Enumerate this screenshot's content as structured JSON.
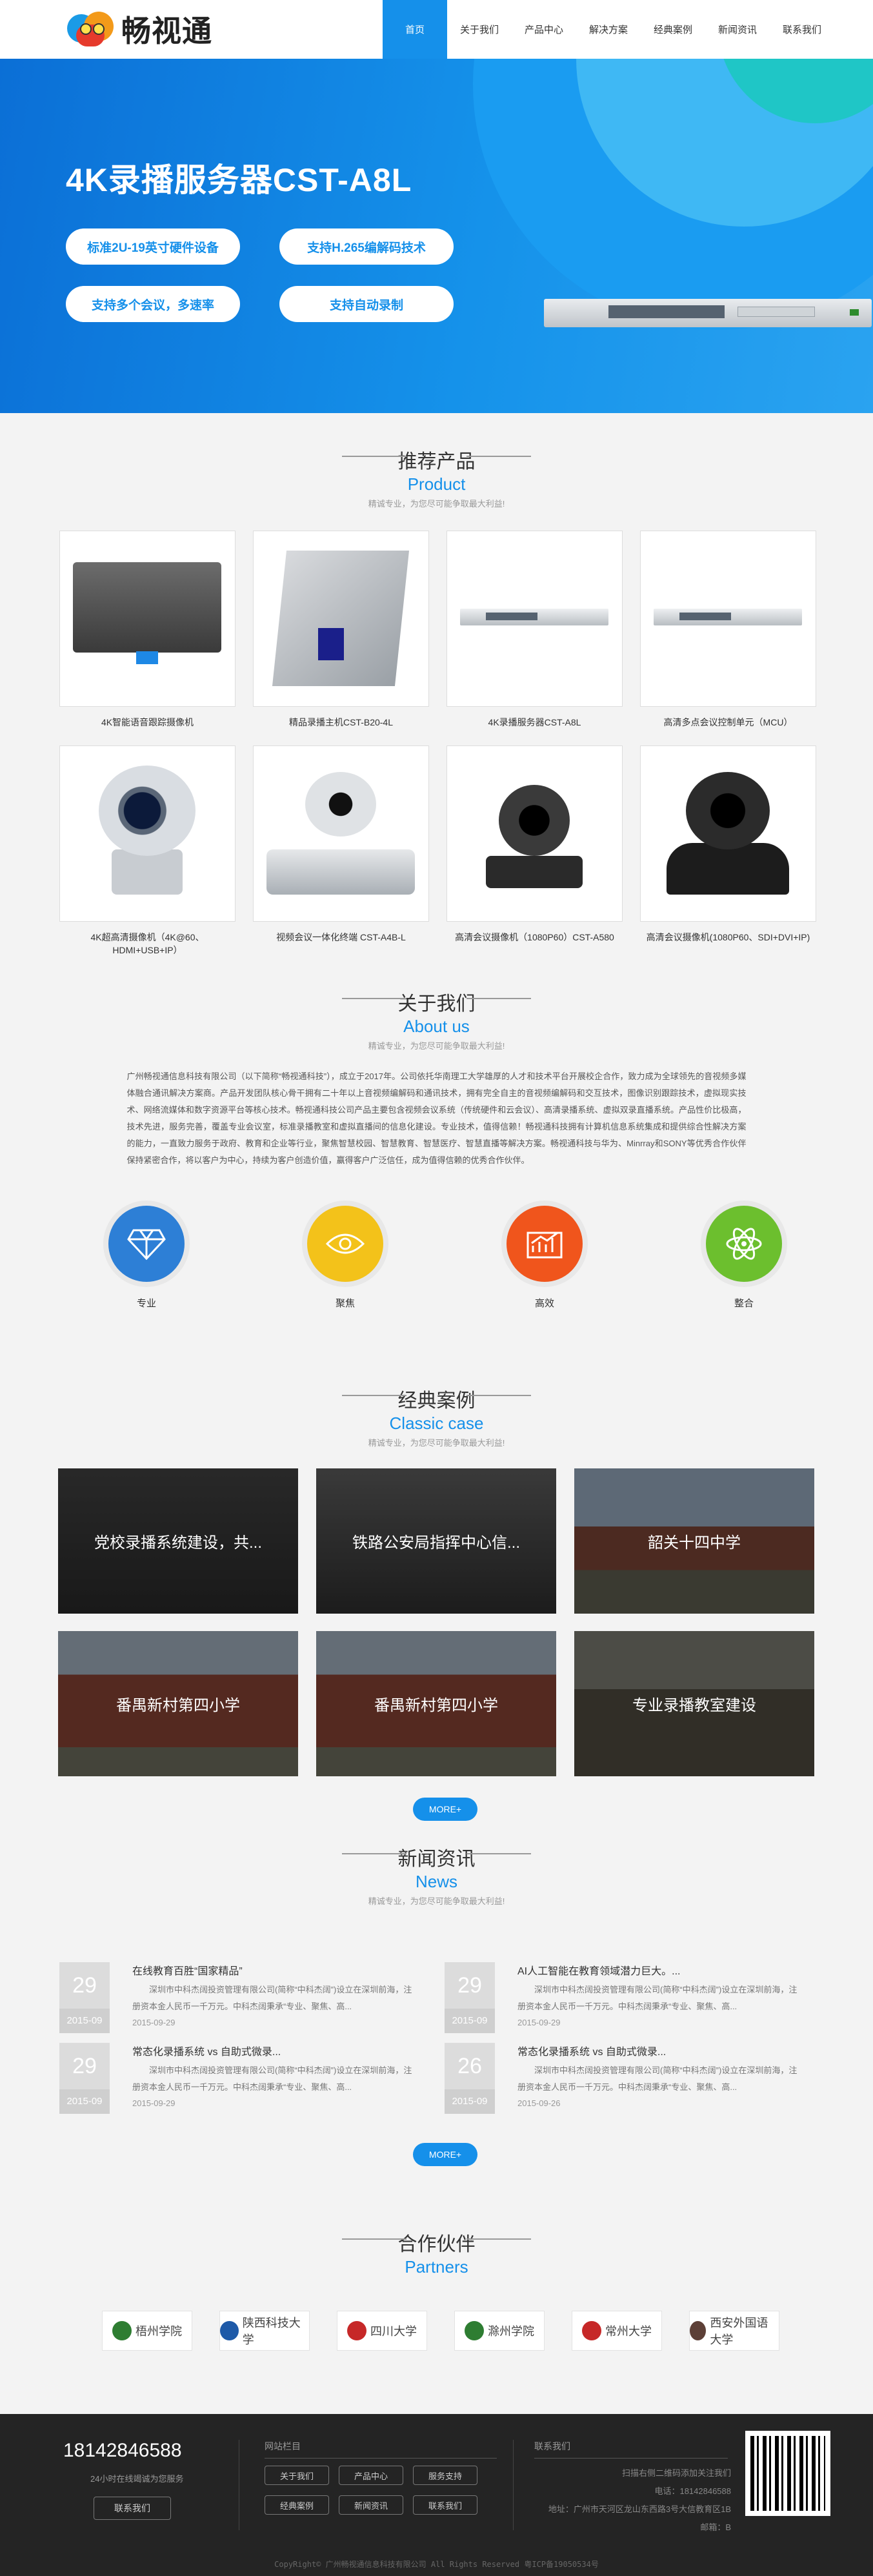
{
  "header": {
    "brand": "畅视通",
    "nav": [
      "首页",
      "关于我们",
      "产品中心",
      "解决方案",
      "经典案例",
      "新闻资讯",
      "联系我们"
    ],
    "active_index": 0
  },
  "banner": {
    "title": "4K录播服务器CST-A8L",
    "pills": [
      "标准2U-19英寸硬件设备",
      "支持H.265编解码技术",
      "支持多个会议，多速率",
      "支持自动录制"
    ],
    "slide_count": 3,
    "active_slide": 0
  },
  "products": {
    "title_cn": "推荐产品",
    "title_en": "Product",
    "subtitle": "精诚专业，为您尽可能争取最大利益!",
    "items": [
      {
        "name": "4K智能语音跟踪摄像机",
        "icon": "soundbar-camera"
      },
      {
        "name": "精品录播主机CST-B20-4L",
        "icon": "recording-host"
      },
      {
        "name": "4K录播服务器CST-A8L",
        "icon": "rack-server"
      },
      {
        "name": "高清多点会议控制单元（MCU）",
        "icon": "rack-server"
      },
      {
        "name": "4K超高清摄像机（4K@60、HDMI+USB+IP）",
        "icon": "ptz-camera"
      },
      {
        "name": "视频会议一体化终端 CST-A4B-L",
        "icon": "video-terminal"
      },
      {
        "name": "高清会议摄像机（1080P60）CST-A580",
        "icon": "ptz-camera"
      },
      {
        "name": "高清会议摄像机(1080P60、SDI+DVI+IP)",
        "icon": "ptz-camera-black"
      }
    ]
  },
  "about": {
    "title_cn": "关于我们",
    "title_en": "About us",
    "subtitle": "精诚专业，为您尽可能争取最大利益!",
    "text": "广州畅视通信息科技有限公司（以下简称“畅视通科技”），成立于2017年。公司依托华南理工大学雄厚的人才和技术平台开展校企合作，致力成为全球领先的音视频多媒体融合通讯解决方案商。产品开发团队核心骨干拥有二十年以上音视频编解码和通讯技术，拥有完全自主的音视频编解码和交互技术，图像识别跟踪技术，虚拟现实技术、网络流媒体和数字资源平台等核心技术。畅视通科技公司产品主要包含视频会议系统（传统硬件和云会议）、高清录播系统、虚拟双录直播系统。产品性价比极高，技术先进，服务完善，覆盖专业会议室，标准录播教室和虚拟直播间的信息化建设。专业技术，值得信赖！畅视通科技拥有计算机信息系统集成和提供综合性解决方案的能力，一直致力服务于政府、教育和企业等行业，聚焦智慧校园、智慧教育、智慧医疗、智慧直播等解决方案。畅视通科技与华为、Minrray和SONY等优秀合作伙伴保持紧密合作，将以客户为中心，持续为客户创造价值，赢得客户广泛信任，成为值得信赖的优秀合作伙伴。",
    "features": [
      {
        "label": "专业",
        "icon": "diamond-icon",
        "color": "#2d7fd6"
      },
      {
        "label": "聚焦",
        "icon": "eye-icon",
        "color": "#f3c21a"
      },
      {
        "label": "高效",
        "icon": "chart-icon",
        "color": "#f0551c"
      },
      {
        "label": "整合",
        "icon": "atom-icon",
        "color": "#6cbf2e"
      }
    ]
  },
  "cases": {
    "title_cn": "经典案例",
    "title_en": "Classic case",
    "subtitle": "精诚专业，为您尽可能争取最大利益!",
    "items": [
      {
        "title": "党校录播系统建设，共...",
        "bg": "#3c3c3c"
      },
      {
        "title": "铁路公安局指挥中心信...",
        "bg": "#4a4a4a"
      },
      {
        "title": "韶关十四中学",
        "bg": "#6f7f8f"
      },
      {
        "title": "番禺新村第四小学",
        "bg": "#8a5a46"
      },
      {
        "title": "番禺新村第四小学",
        "bg": "#8a5a46"
      },
      {
        "title": "专业录播教室建设",
        "bg": "#5d5d55"
      }
    ],
    "more": "MORE+"
  },
  "news": {
    "title_cn": "新闻资讯",
    "title_en": "News",
    "subtitle": "精诚专业，为您尽可能争取最大利益!",
    "items": [
      {
        "day": "29",
        "ym": "2015-09",
        "title": "在线教育百胜“国家精品”",
        "desc": "深圳市中科杰阔投资管理有限公司(简称“中科杰阔”)设立在深圳前海，注册资本金人民币一千万元。中科杰阔秉承“专业、聚焦、高...",
        "date": "2015-09-29"
      },
      {
        "day": "29",
        "ym": "2015-09",
        "title": "AI人工智能在教育领域潜力巨大。...",
        "desc": "深圳市中科杰阔投资管理有限公司(简称“中科杰阔”)设立在深圳前海，注册资本金人民币一千万元。中科杰阔秉承“专业、聚焦、高...",
        "date": "2015-09-29"
      },
      {
        "day": "29",
        "ym": "2015-09",
        "title": "常态化录播系统 vs 自助式微录...",
        "desc": "深圳市中科杰阔投资管理有限公司(简称“中科杰阔”)设立在深圳前海，注册资本金人民币一千万元。中科杰阔秉承“专业、聚焦、高...",
        "date": "2015-09-29"
      },
      {
        "day": "26",
        "ym": "2015-09",
        "title": "常态化录播系统 vs 自助式微录...",
        "desc": "深圳市中科杰阔投资管理有限公司(简称“中科杰阔”)设立在深圳前海，注册资本金人民币一千万元。中科杰阔秉承“专业、聚焦、高...",
        "date": "2015-09-26"
      }
    ],
    "more": "MORE+"
  },
  "partners": {
    "title_cn": "合作伙伴",
    "title_en": "Partners",
    "items": [
      {
        "name": "梧州学院",
        "color": "#2e7d32"
      },
      {
        "name": "陕西科技大学",
        "color": "#1e5aa8"
      },
      {
        "name": "四川大学",
        "color": "#c62828"
      },
      {
        "name": "滁州学院",
        "color": "#2e7d32"
      },
      {
        "name": "常州大学",
        "color": "#c62828"
      },
      {
        "name": "西安外国语大学",
        "color": "#5d4037"
      }
    ]
  },
  "footer": {
    "phone": "18142846588",
    "hours": "24小时在线竭诚为您服务",
    "contact_button": "联系我们",
    "nav_head": "网站栏目",
    "nav_links": [
      "关于我们",
      "产品中心",
      "服务支持",
      "经典案例",
      "新闻资讯",
      "联系我们"
    ],
    "contact_head": "联系我们",
    "contact_lines": [
      "扫描右侧二维码添加关注我们",
      "电话：18142846588",
      "地址：广州市天河区龙山东西路3号大信教育区1B",
      "邮箱：B"
    ],
    "copyright": "CopyRight© 广州畅视通信息科技有限公司 All Rights Reserved  粤ICP备19050534号"
  }
}
